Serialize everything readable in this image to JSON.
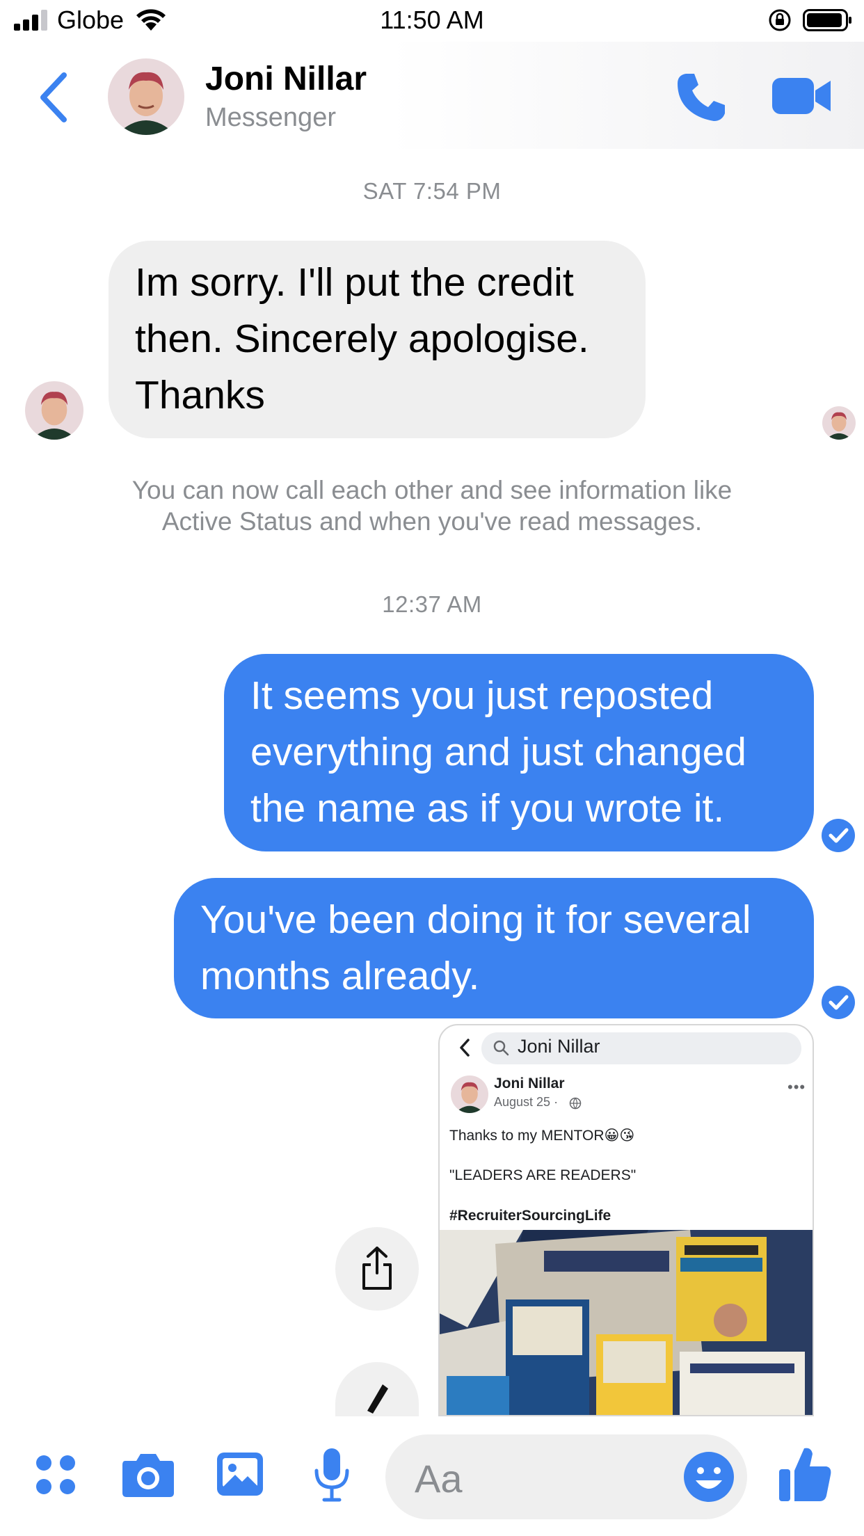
{
  "status_bar": {
    "carrier": "Globe",
    "time": "11:50 AM"
  },
  "header": {
    "name": "Joni Nillar",
    "subtitle": "Messenger"
  },
  "thread": {
    "timestamp_1": "SAT 7:54 PM",
    "incoming_1": [
      "Im sorry. I'll put the credit",
      "then. Sincerely apologise.",
      "Thanks"
    ],
    "system_note": [
      "You can now call each other and see information like",
      "Active Status and when you've read messages."
    ],
    "timestamp_2": "12:37 AM",
    "outgoing_1": [
      "It seems you just reposted",
      "everything and just changed",
      "the name as if you wrote it."
    ],
    "outgoing_2": [
      "You've been doing it for several",
      "months already."
    ]
  },
  "shared_image": {
    "search_text": "Joni Nillar",
    "post_author": "Joni Nillar",
    "post_date": "August 25 ·",
    "more": "•••",
    "line_1": "Thanks to my MENTOR😀😘",
    "line_2": "\"LEADERS ARE READERS\"",
    "line_3": "#RecruiterSourcingLife"
  },
  "composer": {
    "placeholder": "Aa"
  },
  "colors": {
    "accent": "#3b82f0",
    "incoming_bubble": "#efefef",
    "meta_text": "#8a8d91"
  }
}
